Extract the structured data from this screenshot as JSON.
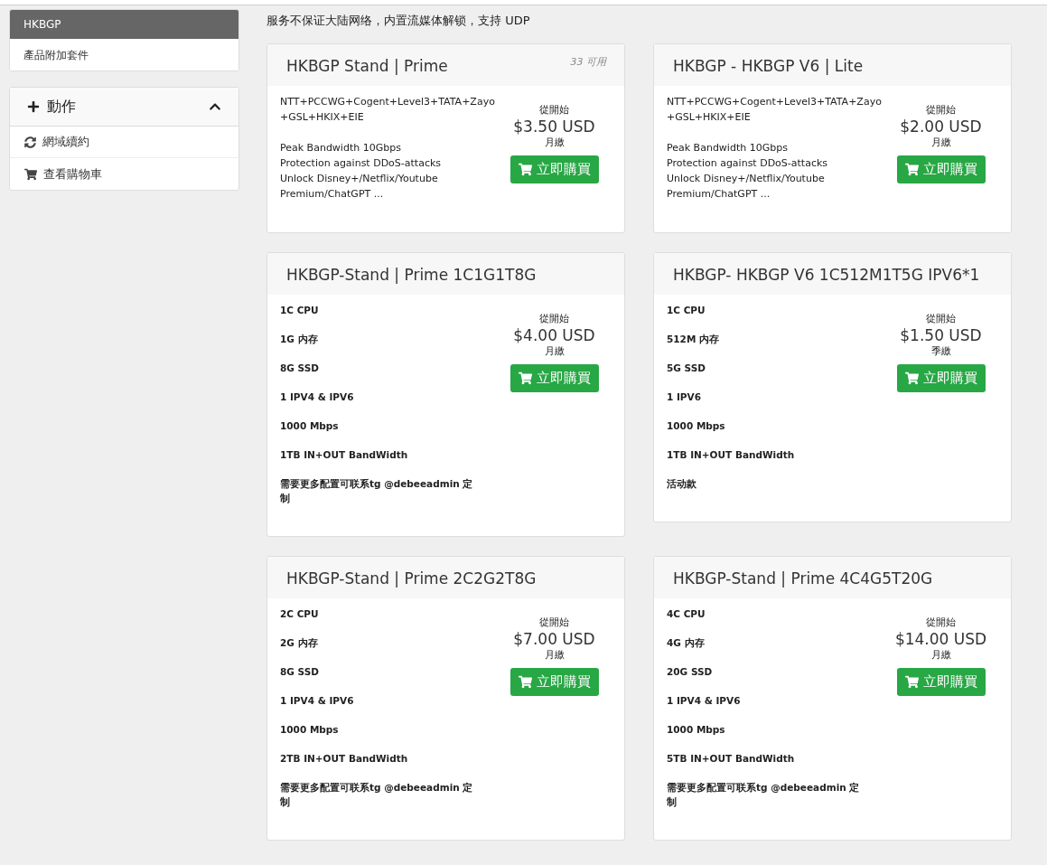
{
  "sidebar": {
    "categories": [
      {
        "label": "HKBGP",
        "selected": true
      },
      {
        "label": "產品附加套件",
        "selected": false
      }
    ],
    "actions": {
      "title": "動作",
      "expanded": true,
      "items": [
        {
          "label": "網域續約",
          "kind": "renew"
        },
        {
          "label": "查看購物車",
          "kind": "cart"
        }
      ]
    }
  },
  "notice": "服务不保证大陆网络，内置流媒体解锁，支持 UDP",
  "products": [
    {
      "title": "HKBGP Stand | Prime",
      "availability": "33 可用",
      "kind": "description",
      "paragraphs": [
        [
          "NTT+PCCWG+Cogent+Level3+TATA+Zayo",
          "+GSL+HKIX+EIE"
        ],
        [
          "Peak Bandwidth 10Gbps",
          "Protection against DDoS-attacks",
          "Unlock Disney+/Netflix/Youtube",
          "Premium/ChatGPT ..."
        ]
      ],
      "from": "從開始",
      "price": "$3.50 USD",
      "cycle": "月繳",
      "button": "立即購買"
    },
    {
      "title": "HKBGP - HKBGP V6 | Lite",
      "kind": "description",
      "paragraphs": [
        [
          "NTT+PCCWG+Cogent+Level3+TATA+Zayo",
          "+GSL+HKIX+EIE"
        ],
        [
          "Peak Bandwidth 10Gbps",
          "Protection against DDoS-attacks",
          "Unlock Disney+/Netflix/Youtube",
          "Premium/ChatGPT ..."
        ]
      ],
      "from": "從開始",
      "price": "$2.00 USD",
      "cycle": "月繳",
      "button": "立即購買"
    },
    {
      "title": "HKBGP-Stand | Prime 1C1G1T8G",
      "kind": "specs",
      "lines": [
        "1C CPU",
        "1G 内存",
        "8G SSD",
        "1 IPV4 & IPV6",
        "1000 Mbps",
        "1TB IN+OUT BandWidth",
        "需要更多配置可联系tg @debeeadmin 定制"
      ],
      "from": "從開始",
      "price": "$4.00 USD",
      "cycle": "月繳",
      "button": "立即購買"
    },
    {
      "title": "HKBGP- HKBGP V6 1C512M1T5G IPV6*1",
      "kind": "specs",
      "lines": [
        "1C CPU",
        "512M 内存",
        "5G SSD",
        "1 IPV6",
        "1000 Mbps",
        "1TB IN+OUT BandWidth",
        "活动款"
      ],
      "from": "從開始",
      "price": "$1.50 USD",
      "cycle": "季繳",
      "button": "立即購買"
    },
    {
      "title": "HKBGP-Stand | Prime 2C2G2T8G",
      "kind": "specs",
      "lines": [
        "2C CPU",
        "2G 内存",
        "8G SSD",
        "1 IPV4 & IPV6",
        "1000 Mbps",
        "2TB IN+OUT BandWidth",
        "需要更多配置可联系tg @debeeadmin 定制"
      ],
      "from": "從開始",
      "price": "$7.00 USD",
      "cycle": "月繳",
      "button": "立即購買"
    },
    {
      "title": "HKBGP-Stand | Prime 4C4G5T20G",
      "kind": "specs",
      "lines": [
        "4C CPU",
        "4G 内存",
        "20G SSD",
        "1 IPV4 & IPV6",
        "1000 Mbps",
        "5TB IN+OUT BandWidth",
        "需要更多配置可联系tg @debeeadmin 定制"
      ],
      "from": "從開始",
      "price": "$14.00 USD",
      "cycle": "月繳",
      "button": "立即購買"
    }
  ]
}
